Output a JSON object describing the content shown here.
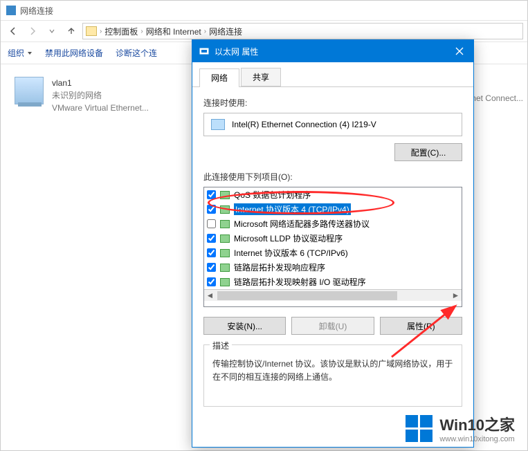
{
  "explorer": {
    "window_title": "网络连接",
    "breadcrumb": [
      "控制面板",
      "网络和 Internet",
      "网络连接"
    ],
    "cmdbar": {
      "organize": "组织",
      "disable": "禁用此网络设备",
      "diagnose": "诊断这个连"
    },
    "connection": {
      "name": "vlan1",
      "status": "未识别的网络",
      "device": "VMware Virtual Ethernet..."
    },
    "partial_right": "net Connect..."
  },
  "dialog": {
    "title": "以太网 属性",
    "tabs": {
      "network": "网络",
      "sharing": "共享"
    },
    "connect_using_label": "连接时使用:",
    "adapter_name": "Intel(R) Ethernet Connection (4) I219-V",
    "configure_btn": "配置(C)...",
    "items_label": "此连接使用下列项目(O):",
    "items": [
      {
        "label": "QoS 数据包计划程序",
        "checked": true,
        "selected": false
      },
      {
        "label": "Internet 协议版本 4 (TCP/IPv4)",
        "checked": true,
        "selected": true
      },
      {
        "label": "Microsoft 网络适配器多路传送器协议",
        "checked": false,
        "selected": false
      },
      {
        "label": "Microsoft LLDP 协议驱动程序",
        "checked": true,
        "selected": false
      },
      {
        "label": "Internet 协议版本 6 (TCP/IPv6)",
        "checked": true,
        "selected": false
      },
      {
        "label": "链路层拓扑发现响应程序",
        "checked": true,
        "selected": false
      },
      {
        "label": "链路层拓扑发现映射器 I/O 驱动程序",
        "checked": true,
        "selected": false
      }
    ],
    "install_btn": "安装(N)...",
    "uninstall_btn": "卸载(U)",
    "properties_btn": "属性(R)",
    "desc_legend": "描述",
    "desc_text": "传输控制协议/Internet 协议。该协议是默认的广域网络协议，用于在不同的相互连接的网络上通信。"
  },
  "watermark": {
    "main": "Win10之家",
    "sub": "www.win10xitong.com"
  }
}
